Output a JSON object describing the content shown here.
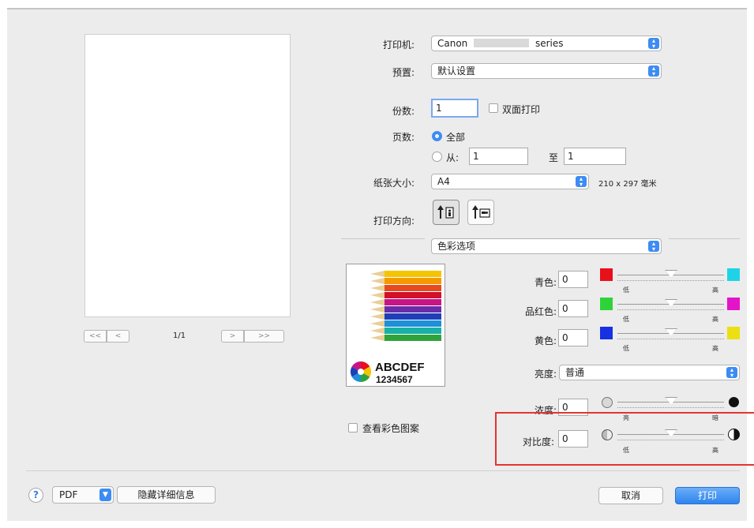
{
  "preview": {
    "page_label": "1/1",
    "first_btn": "<<",
    "prev_btn": "<",
    "next_btn": ">",
    "last_btn": ">>"
  },
  "printer": {
    "label": "打印机:",
    "value": "Canon",
    "suffix": "series"
  },
  "presets": {
    "label": "预置:",
    "value": "默认设置"
  },
  "copies": {
    "label": "份数:",
    "value": "1",
    "duplex_label": "双面打印"
  },
  "pages": {
    "label": "页数:",
    "all_label": "全部",
    "from_label": "从:",
    "from_value": "1",
    "to_label": "至",
    "to_value": "1"
  },
  "paper_size": {
    "label": "纸张大小:",
    "value": "A4",
    "dimensions": "210 x 297 毫米"
  },
  "orientation": {
    "label": "打印方向:"
  },
  "panel_menu": {
    "value": "色彩选项"
  },
  "sample": {
    "text1": "ABCDEF",
    "text2": "1234567"
  },
  "view_color_pattern": {
    "label": "查看彩色图案"
  },
  "color_adjust": [
    {
      "label": "青色:",
      "value": "0",
      "low": "低",
      "high": "高",
      "color_low": "#e8101a",
      "color_high": "#1fd3e6"
    },
    {
      "label": "品红色:",
      "value": "0",
      "low": "低",
      "high": "高",
      "color_low": "#2ed33a",
      "color_high": "#e414c8"
    },
    {
      "label": "黄色:",
      "value": "0",
      "low": "低",
      "high": "高",
      "color_low": "#1630e2",
      "color_high": "#ecdf12"
    }
  ],
  "brightness": {
    "label": "亮度:",
    "value": "普通"
  },
  "intensity": {
    "label": "浓度:",
    "value": "0",
    "low": "亮",
    "high": "暗"
  },
  "contrast": {
    "label": "对比度:",
    "value": "0",
    "low": "低",
    "high": "高"
  },
  "highlight_color": "#e53333",
  "footer": {
    "help": "?",
    "pdf": "PDF",
    "hide_details": "隐藏详细信息",
    "cancel": "取消",
    "print": "打印"
  }
}
